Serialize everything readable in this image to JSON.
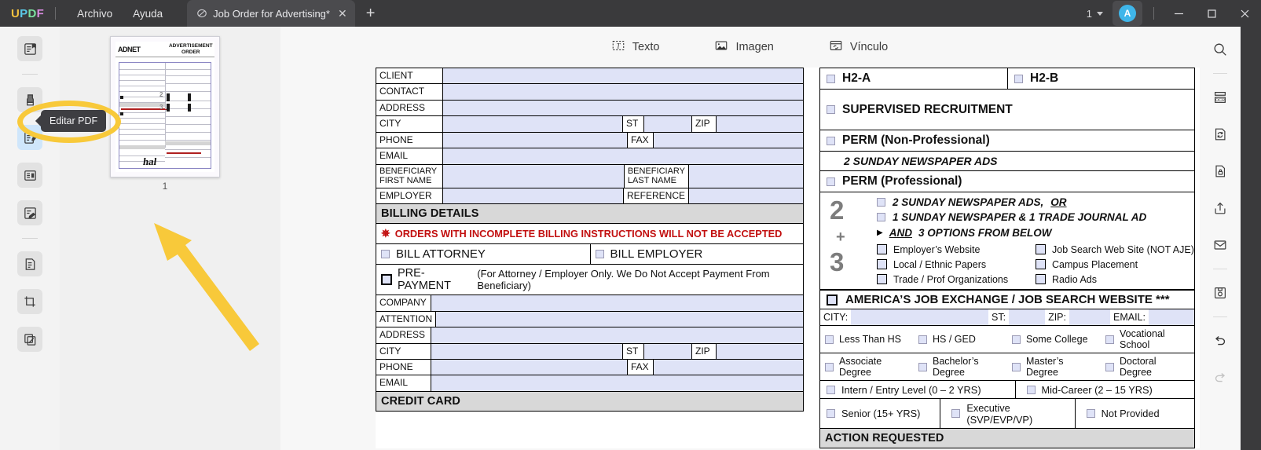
{
  "app": {
    "brand_letters": [
      "U",
      "P",
      "D",
      "F"
    ],
    "brand_colors": [
      "#f5c23e",
      "#5ac8e8",
      "#7be0a0",
      "#d98be0"
    ],
    "accent": "#3fb6ea",
    "annotation_color": "#f8c93a"
  },
  "titlebar": {
    "menus": [
      {
        "label": "Archivo",
        "name": "menu-archivo"
      },
      {
        "label": "Ayuda",
        "name": "menu-ayuda"
      }
    ],
    "tab": {
      "title": "Job Order for Advertising*",
      "close_label": "✕",
      "icon": "pdf-edit-icon"
    },
    "new_tab_label": "+",
    "page_count": "1",
    "avatar_initial": "A",
    "window_buttons": [
      "minimize",
      "maximize",
      "close"
    ]
  },
  "left_rail": {
    "items": [
      {
        "name": "sidebar-reader-icon",
        "icon": "reader-icon",
        "active": false
      },
      {
        "name": "sidebar-annotate-icon",
        "icon": "highlighter-icon",
        "active": false
      },
      {
        "name": "sidebar-edit-pdf-icon",
        "icon": "edit-pdf-icon",
        "active": true
      },
      {
        "name": "sidebar-page-organize-icon",
        "icon": "page-list-icon",
        "active": false
      },
      {
        "name": "sidebar-form-icon",
        "icon": "form-fill-icon",
        "active": false
      },
      {
        "name": "sidebar-ocr-doc-icon",
        "icon": "document-scan-icon",
        "active": false
      },
      {
        "name": "sidebar-crop-icon",
        "icon": "crop-icon",
        "active": false
      },
      {
        "name": "sidebar-batch-icon",
        "icon": "batch-pages-icon",
        "active": false
      }
    ]
  },
  "tooltip": {
    "text": "Editar PDF"
  },
  "thumbnail_panel": {
    "page_label": "1",
    "doc_logo": "ADNET",
    "doc_title_line1": "ADVERTISEMENT",
    "doc_title_line2": "ORDER",
    "signature": "hal"
  },
  "doc_toolbar": {
    "buttons": [
      {
        "label": "Texto",
        "icon": "text-box-icon",
        "name": "add-text-button"
      },
      {
        "label": "Imagen",
        "icon": "image-icon",
        "name": "add-image-button"
      },
      {
        "label": "Vínculo",
        "icon": "link-card-icon",
        "name": "add-link-button"
      }
    ]
  },
  "right_rail": {
    "items": [
      {
        "name": "search-icon",
        "icon": "search-icon",
        "disabled": false
      },
      {
        "name": "ocr-icon",
        "icon": "ocr-icon",
        "disabled": false
      },
      {
        "name": "convert-pdf-icon",
        "icon": "convert-document-icon",
        "disabled": false
      },
      {
        "name": "protect-pdf-icon",
        "icon": "document-lock-icon",
        "disabled": false
      },
      {
        "name": "share-pdf-icon",
        "icon": "share-upload-icon",
        "disabled": false
      },
      {
        "name": "email-pdf-icon",
        "icon": "envelope-icon",
        "disabled": false
      },
      {
        "name": "save-pdf-icon",
        "icon": "floppy-disk-icon",
        "disabled": false
      },
      {
        "name": "undo-icon",
        "icon": "undo-arrow-icon",
        "disabled": false
      },
      {
        "name": "redo-icon",
        "icon": "redo-arrow-icon",
        "disabled": true
      }
    ]
  },
  "document": {
    "left_column": {
      "contact_rows": [
        {
          "label": "CLIENT",
          "value": ""
        },
        {
          "label": "CONTACT",
          "value": ""
        },
        {
          "label": "ADDRESS",
          "value": ""
        }
      ],
      "city_row": {
        "label": "CITY",
        "st_label": "ST",
        "zip_label": "ZIP",
        "city": "",
        "st": "",
        "zip": ""
      },
      "phone_row": {
        "label": "PHONE",
        "fax_label": "FAX",
        "phone": "",
        "fax": ""
      },
      "email_row": {
        "label": "EMAIL",
        "value": ""
      },
      "beneficiary_row": {
        "first_label_line1": "BENEFICIARY",
        "first_label_line2": "FIRST NAME",
        "last_label_line1": "BENEFICIARY",
        "last_label_line2": "LAST NAME",
        "first": "",
        "last": ""
      },
      "employer_row": {
        "label": "EMPLOYER",
        "ref_label": "REFERENCE",
        "employer": "",
        "reference": ""
      },
      "billing_header": "BILLING DETAILS",
      "billing_warning": "ORDERS WITH INCOMPLETE BILLING INSTRUCTIONS WILL NOT BE ACCEPTED",
      "bill_options": [
        {
          "label": "BILL ATTORNEY",
          "checked": false
        },
        {
          "label": "BILL EMPLOYER",
          "checked": false
        }
      ],
      "prepayment": {
        "strong": "PRE-PAYMENT",
        "note": "(For Attorney / Employer Only. We Do Not Accept Payment From Beneficiary)",
        "checked": false
      },
      "billing_rows": [
        {
          "label": "COMPANY",
          "value": ""
        },
        {
          "label": "ATTENTION",
          "value": ""
        },
        {
          "label": "ADDRESS",
          "value": ""
        }
      ],
      "billing_city_row": {
        "label": "CITY",
        "st_label": "ST",
        "zip_label": "ZIP",
        "city": "",
        "st": "",
        "zip": ""
      },
      "billing_phone_row": {
        "label": "PHONE",
        "fax_label": "FAX",
        "phone": "",
        "fax": ""
      },
      "billing_email_row": {
        "label": "EMAIL",
        "value": ""
      },
      "credit_card_header": "CREDIT CARD"
    },
    "right_column": {
      "h2_row": [
        {
          "label": "H2-A",
          "checked": false
        },
        {
          "label": "H2-B",
          "checked": false
        }
      ],
      "supervised": {
        "label": "SUPERVISED RECRUITMENT",
        "checked": false
      },
      "perm_non_prof": {
        "label": "PERM (Non-Professional)",
        "checked": false,
        "sub": "2 SUNDAY NEWSPAPER ADS"
      },
      "perm_prof": {
        "label": "PERM (Professional)",
        "checked": false
      },
      "big_num_2": "2",
      "plus_sign": "+",
      "big_num_3": "3",
      "perm_prof_options": [
        {
          "label": "2 SUNDAY NEWSPAPER ADS,",
          "emphasis": "OR",
          "checked": false
        },
        {
          "label": "1 SUNDAY NEWSPAPER & 1 TRADE JOURNAL AD",
          "emphasis": "",
          "checked": false
        }
      ],
      "and_line": {
        "arrow": "▶",
        "bold": "AND",
        "rest": "3 OPTIONS FROM BELOW"
      },
      "options_left": [
        {
          "label": "Employer’s Website",
          "checked": false
        },
        {
          "label": "Local / Ethnic Papers",
          "checked": false
        },
        {
          "label": "Trade / Prof Organizations",
          "checked": false
        }
      ],
      "options_right": [
        {
          "label": "Job Search Web Site (NOT AJE)",
          "checked": false
        },
        {
          "label": "Campus Placement",
          "checked": false
        },
        {
          "label": "Radio Ads",
          "checked": false
        }
      ],
      "aje": {
        "label": "AMERICA’S JOB EXCHANGE / JOB SEARCH WEBSITE ***",
        "checked": false
      },
      "aje_fields": [
        {
          "label": "CITY:",
          "value": ""
        },
        {
          "label": "ST:",
          "value": ""
        },
        {
          "label": "ZIP:",
          "value": ""
        },
        {
          "label": "EMAIL:",
          "value": ""
        }
      ],
      "education_row1": [
        {
          "label": "Less Than HS",
          "checked": false
        },
        {
          "label": "HS / GED",
          "checked": false
        },
        {
          "label": "Some College",
          "checked": false
        },
        {
          "label": "Vocational School",
          "checked": false
        }
      ],
      "education_row2": [
        {
          "label": "Associate Degree",
          "checked": false
        },
        {
          "label": "Bachelor’s Degree",
          "checked": false
        },
        {
          "label": "Master’s Degree",
          "checked": false
        },
        {
          "label": "Doctoral Degree",
          "checked": false
        }
      ],
      "level_row1": [
        {
          "label": "Intern / Entry Level (0 – 2 YRS)",
          "checked": false
        },
        {
          "label": "Mid-Career (2 – 15 YRS)",
          "checked": false
        }
      ],
      "level_row2": [
        {
          "label": "Senior (15+ YRS)",
          "checked": false
        },
        {
          "label": "Executive (SVP/EVP/VP)",
          "checked": false
        },
        {
          "label": "Not Provided",
          "checked": false
        }
      ],
      "action_requested_header": "ACTION REQUESTED"
    }
  }
}
